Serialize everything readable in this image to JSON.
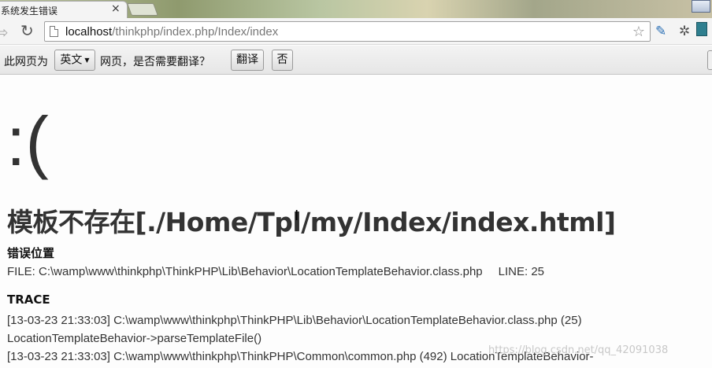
{
  "tab": {
    "title": "系统发生错误",
    "close": "×"
  },
  "toolbar": {
    "back": "⇨",
    "reload": "↻",
    "url_host": "localhost",
    "url_path": "/thinkphp/index.php/Index/index",
    "star": "☆"
  },
  "translate_bar": {
    "prefix": "此网页为",
    "language": "英文",
    "question": "网页，是否需要翻译？",
    "translate_button": "翻译",
    "no_button": "否"
  },
  "error_page": {
    "face": ":(",
    "title": "模板不存在[./Home/Tpl/my/Index/index.html]",
    "location_heading": "错误位置",
    "file_text": "FILE: C:\\wamp\\www\\thinkphp\\ThinkPHP\\Lib\\Behavior\\LocationTemplateBehavior.class.php",
    "line_text": "LINE: 25",
    "trace_heading": "TRACE",
    "trace": [
      "[13-03-23 21:33:03] C:\\wamp\\www\\thinkphp\\ThinkPHP\\Lib\\Behavior\\LocationTemplateBehavior.class.php (25)",
      "LocationTemplateBehavior->parseTemplateFile()",
      "[13-03-23 21:33:03] C:\\wamp\\www\\thinkphp\\ThinkPHP\\Common\\common.php (492) LocationTemplateBehavior-"
    ]
  },
  "watermark": "https://blog.csdn.net/qq_42091038",
  "colors": {
    "text": "#333333",
    "background": "#fdfdfd"
  }
}
